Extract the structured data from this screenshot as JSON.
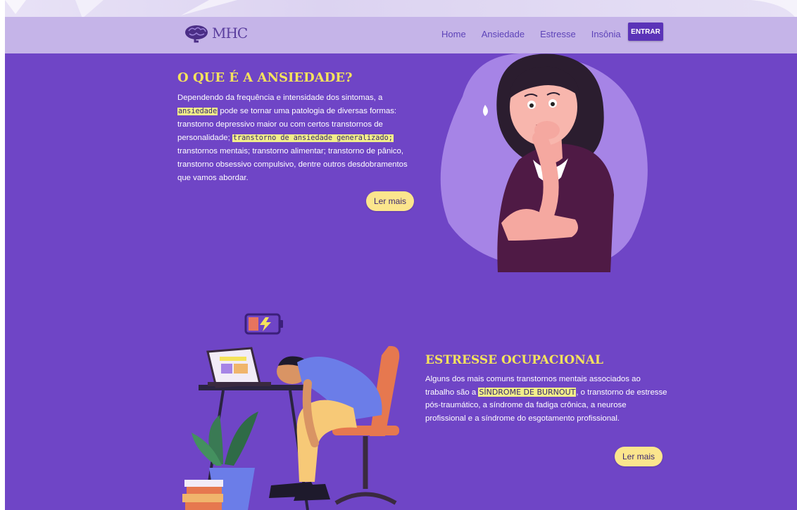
{
  "navbar": {
    "logo_text": "MHC",
    "links": [
      "Home",
      "Ansiedade",
      "Estresse",
      "Insônia"
    ],
    "login_label": "ENTRAR"
  },
  "anxiety": {
    "title": "O QUE É A ANSIEDADE?",
    "text_1": "Dependendo da frequência e intensidade dos sintomas, a ",
    "highlight_1": "ansiedade",
    "text_2": " pode se tornar uma patologia de diversas formas: transtorno depressivo maior ou com certos transtornos de personalidade; ",
    "highlight_2": "transtorno de ansiedade generalizado;",
    "text_3": " transtornos mentais; transtorno alimentar; transtorno de pânico, transtorno obsessivo compulsivo, dentre outros desdobramentos que vamos abordar.",
    "read_more": "Ler mais"
  },
  "stress": {
    "title": "ESTRESSE OCUPACIONAL",
    "text_1": "Alguns dos mais comuns transtornos mentais associados ao trabalho são a ",
    "highlight_1": "SÍNDROME DE BURNOUT",
    "text_2": ", o transtorno de estresse pós-traumático, a síndrome da fadiga crônica, a neurose profissional e a síndrome do esgotamento profissional.",
    "read_more": "Ler mais"
  },
  "colors": {
    "background": "#6f45c6",
    "navbar": "#c5b4e8",
    "title": "#f5e35c",
    "button": "#fbe58d",
    "login_button": "#5b33b8",
    "highlight": "#f2ee8a"
  },
  "icons": [
    "brain-logo-icon",
    "worried-woman-illustration",
    "low-battery-icon",
    "exhausted-worker-illustration"
  ]
}
